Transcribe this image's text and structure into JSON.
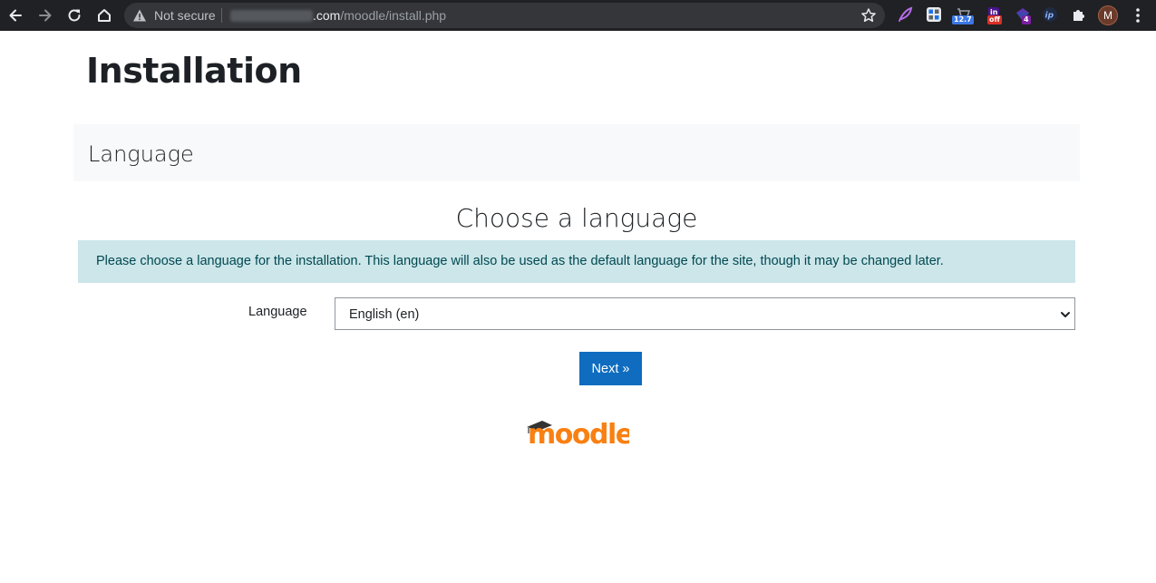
{
  "browser": {
    "security_label": "Not secure",
    "url_host_suffix": ".com",
    "url_path": "/moodle/install.php",
    "extensions": [
      {
        "icon": "feather-icon"
      },
      {
        "icon": "grid-icon"
      },
      {
        "icon": "cart-icon",
        "badge": "12.7",
        "badge_color": "#3b78e7"
      },
      {
        "icon": "in-icon",
        "badge": "off",
        "badge_color": "#d93025"
      },
      {
        "icon": "gem-icon",
        "badge": "4",
        "badge_color": "#7b1fa2"
      },
      {
        "icon": "ip-icon"
      },
      {
        "icon": "puzzle-icon"
      }
    ],
    "profile_initial": "M"
  },
  "page": {
    "title": "Installation",
    "section_title": "Language",
    "heading": "Choose a language",
    "info_text": "Please choose a language for the installation. This language will also be used as the default language for the site, though it may be changed later.",
    "language_label": "Language",
    "language_selected": "English (en)",
    "next_label": "Next »",
    "logo_text": "moodle"
  },
  "colors": {
    "primary": "#0f6cbf",
    "info_bg": "#cce6ea",
    "info_text": "#004950",
    "logo_orange": "#f98012"
  }
}
